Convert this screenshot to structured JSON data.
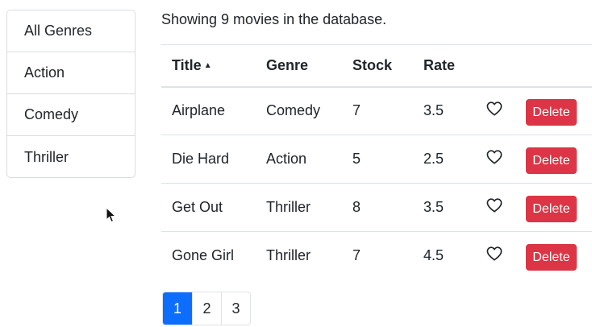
{
  "genres": [
    {
      "label": "All Genres"
    },
    {
      "label": "Action"
    },
    {
      "label": "Comedy"
    },
    {
      "label": "Thriller"
    }
  ],
  "summary": "Showing 9 movies in the database.",
  "table": {
    "headers": {
      "title": "Title",
      "genre": "Genre",
      "stock": "Stock",
      "rate": "Rate"
    },
    "sort": {
      "column": "title",
      "direction": "ascending"
    },
    "rows": [
      {
        "title": "Airplane",
        "genre": "Comedy",
        "stock": "7",
        "rate": "3.5",
        "liked": false,
        "action": "Delete"
      },
      {
        "title": "Die Hard",
        "genre": "Action",
        "stock": "5",
        "rate": "2.5",
        "liked": false,
        "action": "Delete"
      },
      {
        "title": "Get Out",
        "genre": "Thriller",
        "stock": "8",
        "rate": "3.5",
        "liked": false,
        "action": "Delete"
      },
      {
        "title": "Gone Girl",
        "genre": "Thriller",
        "stock": "7",
        "rate": "4.5",
        "liked": false,
        "action": "Delete"
      }
    ]
  },
  "pagination": {
    "pages": [
      "1",
      "2",
      "3"
    ],
    "current": "1"
  },
  "colors": {
    "accent": "#0d6efd",
    "danger": "#dc3545",
    "border": "#dee2e6"
  },
  "icons": {
    "sort": "caret-up-icon",
    "like": "heart-outline-icon",
    "cursor": "mouse-pointer-icon"
  }
}
